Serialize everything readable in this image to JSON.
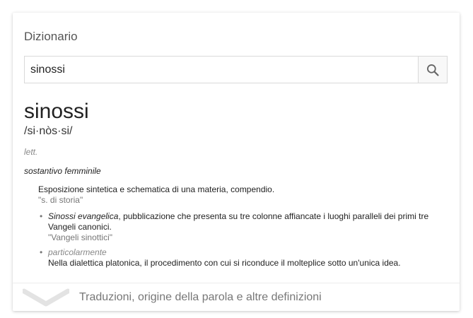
{
  "card": {
    "title": "Dizionario"
  },
  "search": {
    "value": "sinossi",
    "icon": "search-icon"
  },
  "entry": {
    "word": "sinossi",
    "phonetic": "/si·nòs·si/",
    "register": "lett.",
    "part_of_speech": "sostantivo femminile",
    "definition": {
      "text": "Esposizione sintetica e schematica di una materia, compendio.",
      "example": "\"s. di storia\""
    },
    "subdefinitions": [
      {
        "term": "Sinossi evangelica",
        "text": ", pubblicazione che presenta su tre colonne affiancate i luoghi paralleli dei primi tre Vangeli canonici.",
        "example": "\"Vangeli sinottici\""
      },
      {
        "label": "particolarmente",
        "text": "Nella dialettica platonica, il procedimento con cui si riconduce il molteplice sotto un'unica idea."
      }
    ]
  },
  "footer": {
    "label": "Traduzioni, origine della parola e altre definizioni",
    "icon": "chevron-down-icon"
  },
  "colors": {
    "muted_text": "#777777",
    "border": "#d9d9d9"
  }
}
